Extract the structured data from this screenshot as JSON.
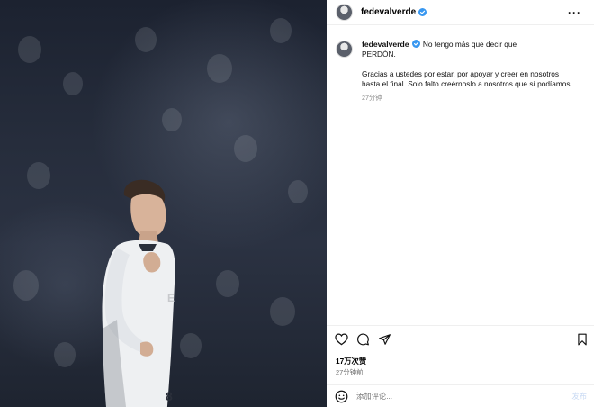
{
  "post": {
    "username": "fedevalverde",
    "verified": true,
    "caption_line1": "No tengo más que decir que",
    "caption_line2": "PERDÓN.",
    "caption_line3": "Gracias a ustedes por estar, por apoyar y creer en nosotros",
    "caption_line4": "hasta el final. Solo falto creérnoslo a nosotros que sí podíamos",
    "caption_time": "27分钟",
    "likes": "17万次赞",
    "posted_ago": "27分钟前"
  },
  "comment": {
    "placeholder": "添加评论...",
    "post_label": "发布"
  },
  "icons": {
    "like": "heart-icon",
    "comment": "comment-icon",
    "share": "paper-plane-icon",
    "save": "bookmark-icon",
    "emoji": "smiley-icon",
    "more": "more-options-icon",
    "verified": "verified-badge-icon"
  },
  "colors": {
    "verified": "#3897f0",
    "muted_text": "#8e8e8e",
    "post_button_disabled": "#c7d9f3"
  }
}
